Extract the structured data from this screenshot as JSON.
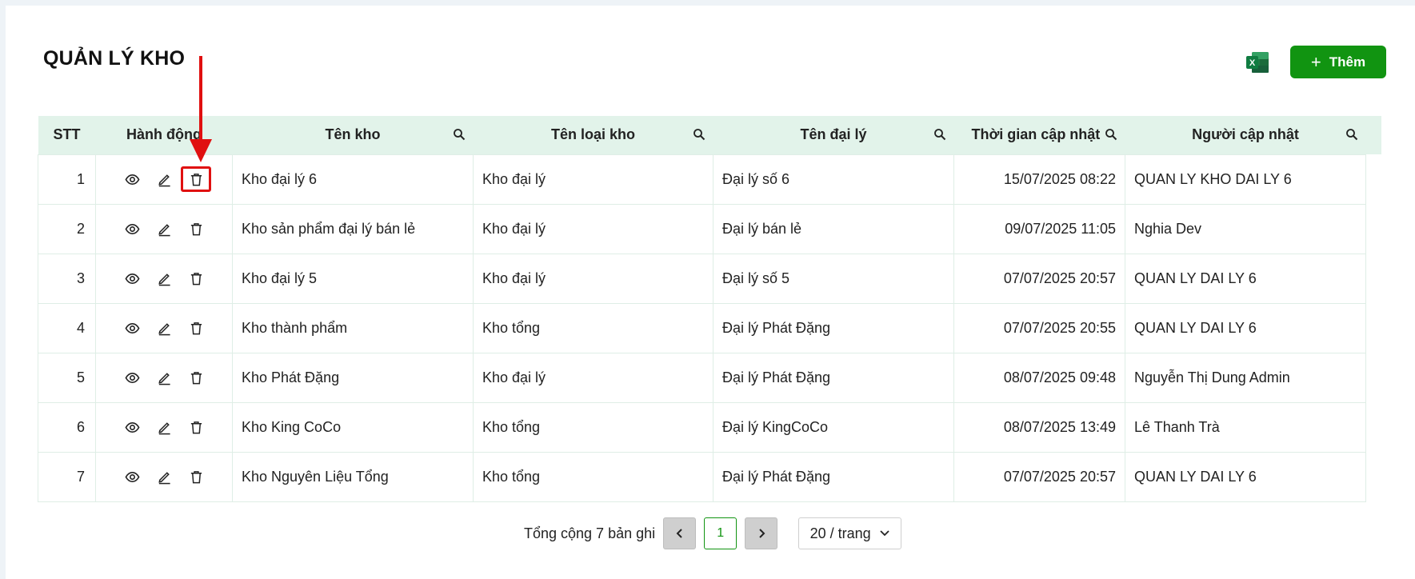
{
  "header": {
    "title": "QUẢN LÝ KHO",
    "add_label": "Thêm"
  },
  "colors": {
    "primary": "#119411",
    "header_bg": "#e2f3ea",
    "highlight": "#e01010"
  },
  "table": {
    "columns": [
      "STT",
      "Hành động",
      "Tên kho",
      "Tên loại kho",
      "Tên đại lý",
      "Thời gian cập nhật",
      "Người cập nhật"
    ],
    "rows": [
      {
        "stt": "1",
        "ten_kho": "Kho đại lý 6",
        "loai_kho": "Kho đại lý",
        "dai_ly": "Đại lý số 6",
        "thoi_gian": "15/07/2025 08:22",
        "nguoi": "QUAN LY KHO DAI LY 6"
      },
      {
        "stt": "2",
        "ten_kho": "Kho sản phẩm đại lý bán lẻ",
        "loai_kho": "Kho đại lý",
        "dai_ly": "Đại lý bán lẻ",
        "thoi_gian": "09/07/2025 11:05",
        "nguoi": "Nghia Dev"
      },
      {
        "stt": "3",
        "ten_kho": "Kho đại lý 5",
        "loai_kho": "Kho đại lý",
        "dai_ly": "Đại lý số 5",
        "thoi_gian": "07/07/2025 20:57",
        "nguoi": "QUAN LY DAI LY 6"
      },
      {
        "stt": "4",
        "ten_kho": "Kho thành phẩm",
        "loai_kho": "Kho tổng",
        "dai_ly": "Đại lý Phát Đặng",
        "thoi_gian": "07/07/2025 20:55",
        "nguoi": "QUAN LY DAI LY 6"
      },
      {
        "stt": "5",
        "ten_kho": "Kho Phát Đặng",
        "loai_kho": "Kho đại lý",
        "dai_ly": "Đại lý Phát Đặng",
        "thoi_gian": "08/07/2025 09:48",
        "nguoi": "Nguyễn Thị Dung Admin"
      },
      {
        "stt": "6",
        "ten_kho": "Kho King CoCo",
        "loai_kho": "Kho tổng",
        "dai_ly": "Đại lý KingCoCo",
        "thoi_gian": "08/07/2025 13:49",
        "nguoi": "Lê Thanh Trà"
      },
      {
        "stt": "7",
        "ten_kho": "Kho Nguyên Liệu Tổng",
        "loai_kho": "Kho tổng",
        "dai_ly": "Đại lý Phát Đặng",
        "thoi_gian": "07/07/2025 20:57",
        "nguoi": "QUAN LY DAI LY 6"
      }
    ]
  },
  "pagination": {
    "total_text": "Tổng cộng 7 bản ghi",
    "current_page": "1",
    "page_size": "20 / trang"
  },
  "icons": {
    "excel": "excel-icon",
    "view": "eye-icon",
    "edit": "pencil-icon",
    "delete": "trash-icon",
    "search": "search-icon"
  }
}
